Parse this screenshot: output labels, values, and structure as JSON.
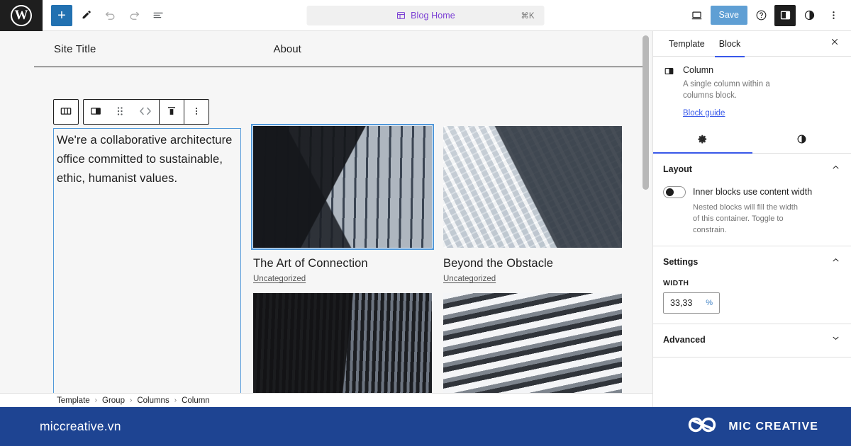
{
  "topbar": {
    "logo_icon": "wordpress-logo-icon",
    "logo_glyph": "W",
    "add_block_label": "+",
    "tools": [
      {
        "name": "add-block-button",
        "icon": "plus-icon"
      },
      {
        "name": "edit-mode-button",
        "icon": "pencil-icon"
      },
      {
        "name": "undo-button",
        "icon": "undo-icon"
      },
      {
        "name": "redo-button",
        "icon": "redo-icon"
      },
      {
        "name": "list-view-button",
        "icon": "list-view-icon"
      }
    ],
    "document_bar": {
      "icon": "template-icon",
      "title": "Blog Home",
      "shortcut": "⌘K"
    },
    "right_tools": [
      {
        "name": "view-button",
        "icon": "laptop-icon"
      },
      {
        "name": "help-button",
        "icon": "question-circle-icon"
      },
      {
        "name": "settings-sidebar-button",
        "icon": "sidebar-panel-icon"
      },
      {
        "name": "styles-button",
        "icon": "half-circle-icon"
      },
      {
        "name": "options-button",
        "icon": "three-dots-vertical-icon"
      }
    ],
    "save_label": "Save"
  },
  "canvas": {
    "site_title": "Site Title",
    "nav_item": "About",
    "block_toolbar": [
      {
        "name": "parent-columns-button",
        "icon": "columns-icon"
      },
      {
        "name": "column-block-type-button",
        "icon": "column-icon"
      },
      {
        "name": "drag-handle",
        "icon": "drag-dots-icon"
      },
      {
        "name": "move-left-right-button",
        "icon": "chevron-left-right-icon"
      },
      {
        "name": "vertical-align-button",
        "icon": "align-top-icon"
      },
      {
        "name": "block-options-button",
        "icon": "three-dots-vertical-icon"
      }
    ],
    "paragraph": "We're a collaborative architecture office committed to sustainable, ethic, humanist values.",
    "posts": [
      {
        "title": "The Art of Connection",
        "category": "Uncategorized",
        "image": "img-a",
        "selected": true
      },
      {
        "title": "Beyond the Obstacle",
        "category": "Uncategorized",
        "image": "img-b",
        "selected": false
      },
      {
        "title": "",
        "category": "",
        "image": "img-c",
        "selected": false
      },
      {
        "title": "",
        "category": "",
        "image": "img-d",
        "selected": false
      }
    ]
  },
  "breadcrumb": {
    "separator": "›",
    "items": [
      "Template",
      "Group",
      "Columns",
      "Column"
    ]
  },
  "sidebar": {
    "tabs": [
      {
        "label": "Template",
        "active": false
      },
      {
        "label": "Block",
        "active": true
      }
    ],
    "close_icon": "close-icon",
    "block": {
      "icon": "column-icon",
      "name": "Column",
      "description": "A single column within a columns block.",
      "guide_link": "Block guide"
    },
    "icon_tabs": [
      {
        "name": "settings-tab",
        "icon": "gear-icon",
        "active": true
      },
      {
        "name": "styles-tab",
        "icon": "half-circle-icon",
        "active": false
      }
    ],
    "layout_panel": {
      "title": "Layout",
      "chevron": "chevron-up-icon",
      "toggle_label": "Inner blocks use content width",
      "toggle_on": false,
      "help_text": "Nested blocks will fill the width of this container. Toggle to constrain."
    },
    "settings_panel": {
      "title": "Settings",
      "chevron": "chevron-up-icon",
      "width_label": "WIDTH",
      "width_value": "33,33",
      "width_unit": "%"
    },
    "advanced_panel": {
      "title": "Advanced",
      "chevron": "chevron-down-icon"
    }
  },
  "banner": {
    "url": "miccreative.vn",
    "brand_name": "MIC CREATIVE",
    "logo_icon": "infinity-loops-logo-icon",
    "background_color": "#1e4492"
  }
}
